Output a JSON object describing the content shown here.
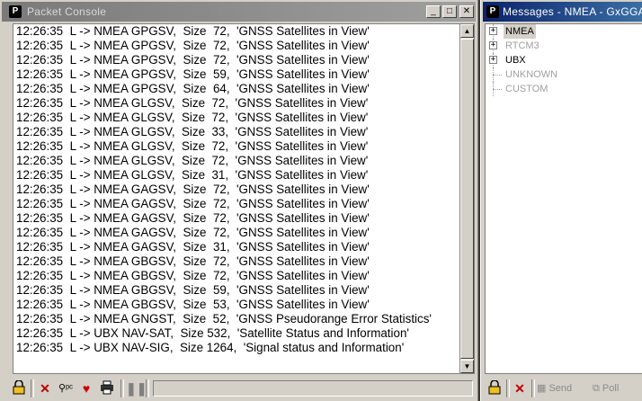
{
  "console": {
    "title": "Packet Console",
    "window_buttons": {
      "minimize": "_",
      "maximize": "□",
      "close": "✕"
    },
    "logo": "P",
    "rows": [
      "12:26:35  L -> NMEA GPGSV,  Size  72,  'GNSS Satellites in View'",
      "12:26:35  L -> NMEA GPGSV,  Size  72,  'GNSS Satellites in View'",
      "12:26:35  L -> NMEA GPGSV,  Size  72,  'GNSS Satellites in View'",
      "12:26:35  L -> NMEA GPGSV,  Size  59,  'GNSS Satellites in View'",
      "12:26:35  L -> NMEA GPGSV,  Size  64,  'GNSS Satellites in View'",
      "12:26:35  L -> NMEA GLGSV,  Size  72,  'GNSS Satellites in View'",
      "12:26:35  L -> NMEA GLGSV,  Size  72,  'GNSS Satellites in View'",
      "12:26:35  L -> NMEA GLGSV,  Size  33,  'GNSS Satellites in View'",
      "12:26:35  L -> NMEA GLGSV,  Size  72,  'GNSS Satellites in View'",
      "12:26:35  L -> NMEA GLGSV,  Size  72,  'GNSS Satellites in View'",
      "12:26:35  L -> NMEA GLGSV,  Size  31,  'GNSS Satellites in View'",
      "12:26:35  L -> NMEA GAGSV,  Size  72,  'GNSS Satellites in View'",
      "12:26:35  L -> NMEA GAGSV,  Size  72,  'GNSS Satellites in View'",
      "12:26:35  L -> NMEA GAGSV,  Size  72,  'GNSS Satellites in View'",
      "12:26:35  L -> NMEA GAGSV,  Size  72,  'GNSS Satellites in View'",
      "12:26:35  L -> NMEA GAGSV,  Size  31,  'GNSS Satellites in View'",
      "12:26:35  L -> NMEA GBGSV,  Size  72,  'GNSS Satellites in View'",
      "12:26:35  L -> NMEA GBGSV,  Size  72,  'GNSS Satellites in View'",
      "12:26:35  L -> NMEA GBGSV,  Size  59,  'GNSS Satellites in View'",
      "12:26:35  L -> NMEA GBGSV,  Size  53,  'GNSS Satellites in View'",
      "12:26:35  L -> NMEA GNGST,  Size  52,  'GNSS Pseudorange Error Statistics'",
      "12:26:35  L -> UBX NAV-SAT,  Size 532,  'Satellite Status and Information'",
      "12:26:35  L -> UBX NAV-SIG,  Size 1264,  'Signal status and Information'"
    ],
    "toolbar_icons": [
      "lock-icon",
      "clear-icon",
      "pc-icon",
      "heart-icon",
      "printer-icon",
      "pause-icon"
    ]
  },
  "messages": {
    "title": "Messages - NMEA - GxGGA (",
    "logo": "P",
    "tree": [
      {
        "label": "NMEA",
        "expander": "+",
        "state": "selected"
      },
      {
        "label": "RTCM3",
        "expander": "+",
        "state": "grey"
      },
      {
        "label": "UBX",
        "expander": "+",
        "state": "normal"
      },
      {
        "label": "UNKNOWN",
        "expander": "",
        "state": "grey"
      },
      {
        "label": "CUSTOM",
        "expander": "",
        "state": "grey"
      }
    ],
    "toolbar": {
      "send_label": "Send",
      "poll_label": "Poll"
    }
  },
  "colors": {
    "desktop": "#3a3a2e",
    "active_title": "#0a246a",
    "inactive_title": "#808080",
    "face": "#d4d0c8"
  }
}
